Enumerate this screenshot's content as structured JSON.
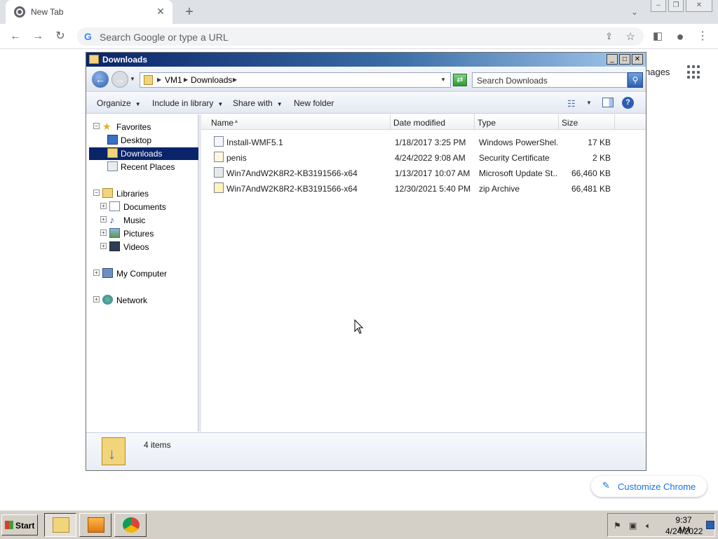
{
  "browser": {
    "tab": {
      "title": "New Tab",
      "close": "✕"
    },
    "new_tab": "+",
    "tab_search": "⌄",
    "window_controls": {
      "minimize": "–",
      "restore": "❐",
      "close": "✕"
    },
    "nav": {
      "back": "←",
      "forward": "→",
      "reload": "↻"
    },
    "omnibox": {
      "placeholder": "Search Google or type a URL",
      "g": "G",
      "share": "⇪",
      "star": "☆"
    },
    "side_panel": "◧",
    "profile": "●",
    "menu": "⋮",
    "ntp": {
      "images_partial": "nages",
      "customize_label": "Customize Chrome",
      "pencil": "✎"
    }
  },
  "explorer": {
    "title": "Downloads",
    "title_controls": {
      "minimize": "_",
      "maximize": "□",
      "close": "✕"
    },
    "back": "←",
    "forward": "→",
    "breadcrumb": [
      "VM1",
      "Downloads"
    ],
    "search_placeholder": "Search Downloads",
    "commands": {
      "organize": "Organize",
      "include_in_library": "Include in library",
      "share_with": "Share with",
      "new_folder": "New folder"
    },
    "help": "?",
    "nav": {
      "favorites": "Favorites",
      "desktop": "Desktop",
      "downloads": "Downloads",
      "recent_places": "Recent Places",
      "libraries": "Libraries",
      "documents": "Documents",
      "music": "Music",
      "pictures": "Pictures",
      "videos": "Videos",
      "my_computer": "My Computer",
      "network": "Network"
    },
    "columns": {
      "name": "Name",
      "date_modified": "Date modified",
      "type": "Type",
      "size": "Size"
    },
    "files": [
      {
        "name": "Install-WMF5.1",
        "date": "1/18/2017 3:25 PM",
        "type": "Windows PowerShel...",
        "size": "17 KB"
      },
      {
        "name": "penis",
        "date": "4/24/2022 9:08 AM",
        "type": "Security Certificate",
        "size": "2 KB"
      },
      {
        "name": "Win7AndW2K8R2-KB3191566-x64",
        "date": "1/13/2017 10:07 AM",
        "type": "Microsoft Update St...",
        "size": "66,460 KB"
      },
      {
        "name": "Win7AndW2K8R2-KB3191566-x64",
        "date": "12/30/2021 5:40 PM",
        "type": "zip Archive",
        "size": "66,481 KB"
      }
    ],
    "status": {
      "item_count": "4 items"
    }
  },
  "taskbar": {
    "start_label": "Start",
    "clock": {
      "time": "9:37 AM",
      "date": "4/24/2022"
    }
  },
  "colors": {
    "selection": "#0a246a",
    "title_gradient_start": "#0a246a",
    "accent_link": "#1a73e8"
  }
}
